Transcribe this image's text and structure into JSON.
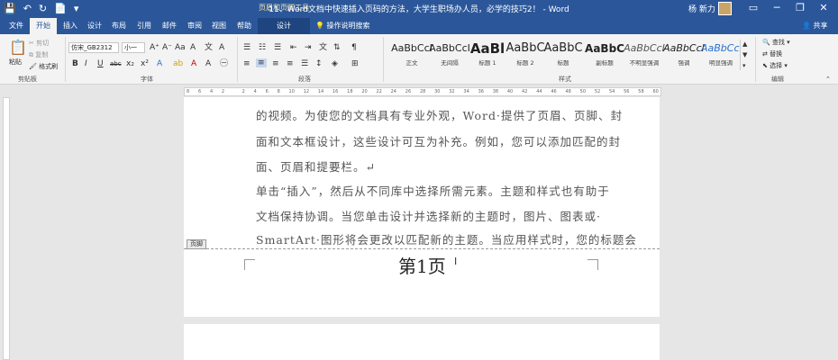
{
  "titlebar": {
    "title": "11、Word文档中快速插入页码的方法，大学生职场办人员，必学的技巧2！ - Word",
    "context_tools": "页眉和页脚工具",
    "user": "杨 新力",
    "qat": [
      "💾",
      "↶",
      "↻",
      "📄",
      "▾"
    ],
    "controls": [
      "▭",
      "─",
      "❐",
      "✕"
    ]
  },
  "tabs": [
    "文件",
    "开始",
    "插入",
    "设计",
    "布局",
    "引用",
    "邮件",
    "审阅",
    "视图",
    "帮助"
  ],
  "context_tab": "设计",
  "tell_me": "操作说明搜索",
  "share": "共享",
  "ribbon": {
    "clipboard": {
      "paste": "粘贴",
      "cut": "剪切",
      "copy": "复制",
      "format_painter": "格式刷",
      "label": "剪贴板"
    },
    "font": {
      "name": "仿宋_GB2312",
      "size": "小一",
      "label": "字体",
      "buttons": [
        "B",
        "I",
        "U",
        "abc",
        "x₂",
        "x²"
      ]
    },
    "paragraph": {
      "label": "段落"
    },
    "styles": {
      "label": "样式",
      "items": [
        {
          "sample": "AaBbCcI",
          "name": "正文"
        },
        {
          "sample": "AaBbCcI",
          "name": "无间隔"
        },
        {
          "sample": "AaBl",
          "name": "标题 1"
        },
        {
          "sample": "AaBbC",
          "name": "标题 2"
        },
        {
          "sample": "AaBbC",
          "name": "标题"
        },
        {
          "sample": "AaBbC",
          "name": "副标题"
        },
        {
          "sample": "AaBbCcI",
          "name": "不明显强调"
        },
        {
          "sample": "AaBbCcI",
          "name": "强调"
        },
        {
          "sample": "AaBbCcI",
          "name": "明显强调"
        }
      ]
    },
    "editing": {
      "find": "查找",
      "replace": "替换",
      "select": "选择",
      "label": "编辑"
    }
  },
  "ruler": [
    "8",
    "6",
    "4",
    "2",
    "",
    "2",
    "4",
    "6",
    "8",
    "10",
    "12",
    "14",
    "16",
    "18",
    "20",
    "22",
    "24",
    "26",
    "28",
    "30",
    "32",
    "34",
    "36",
    "38",
    "40",
    "42",
    "44",
    "46",
    "48",
    "50",
    "52",
    "54",
    "56",
    "58",
    "60"
  ],
  "document": {
    "lines": [
      "的视频。为使您的文档具有专业外观，Word·提供了页眉、页脚、封",
      "面和文本框设计，这些设计可互为补充。例如，您可以添加匹配的封",
      "面、页眉和提要栏。↵",
      "单击“插入”，然后从不同库中选择所需元素。主题和样式也有助于",
      "文档保持协调。当您单击设计并选择新的主题时，图片、图表或·",
      "SmartArt·图形将会更改以匹配新的主题。当应用样式时，您的标题会"
    ],
    "footer_tag": "页脚",
    "page_number": "第1页"
  },
  "colors": {
    "word_blue": "#2b579a",
    "ribbon_bg": "#f3f3f3"
  }
}
